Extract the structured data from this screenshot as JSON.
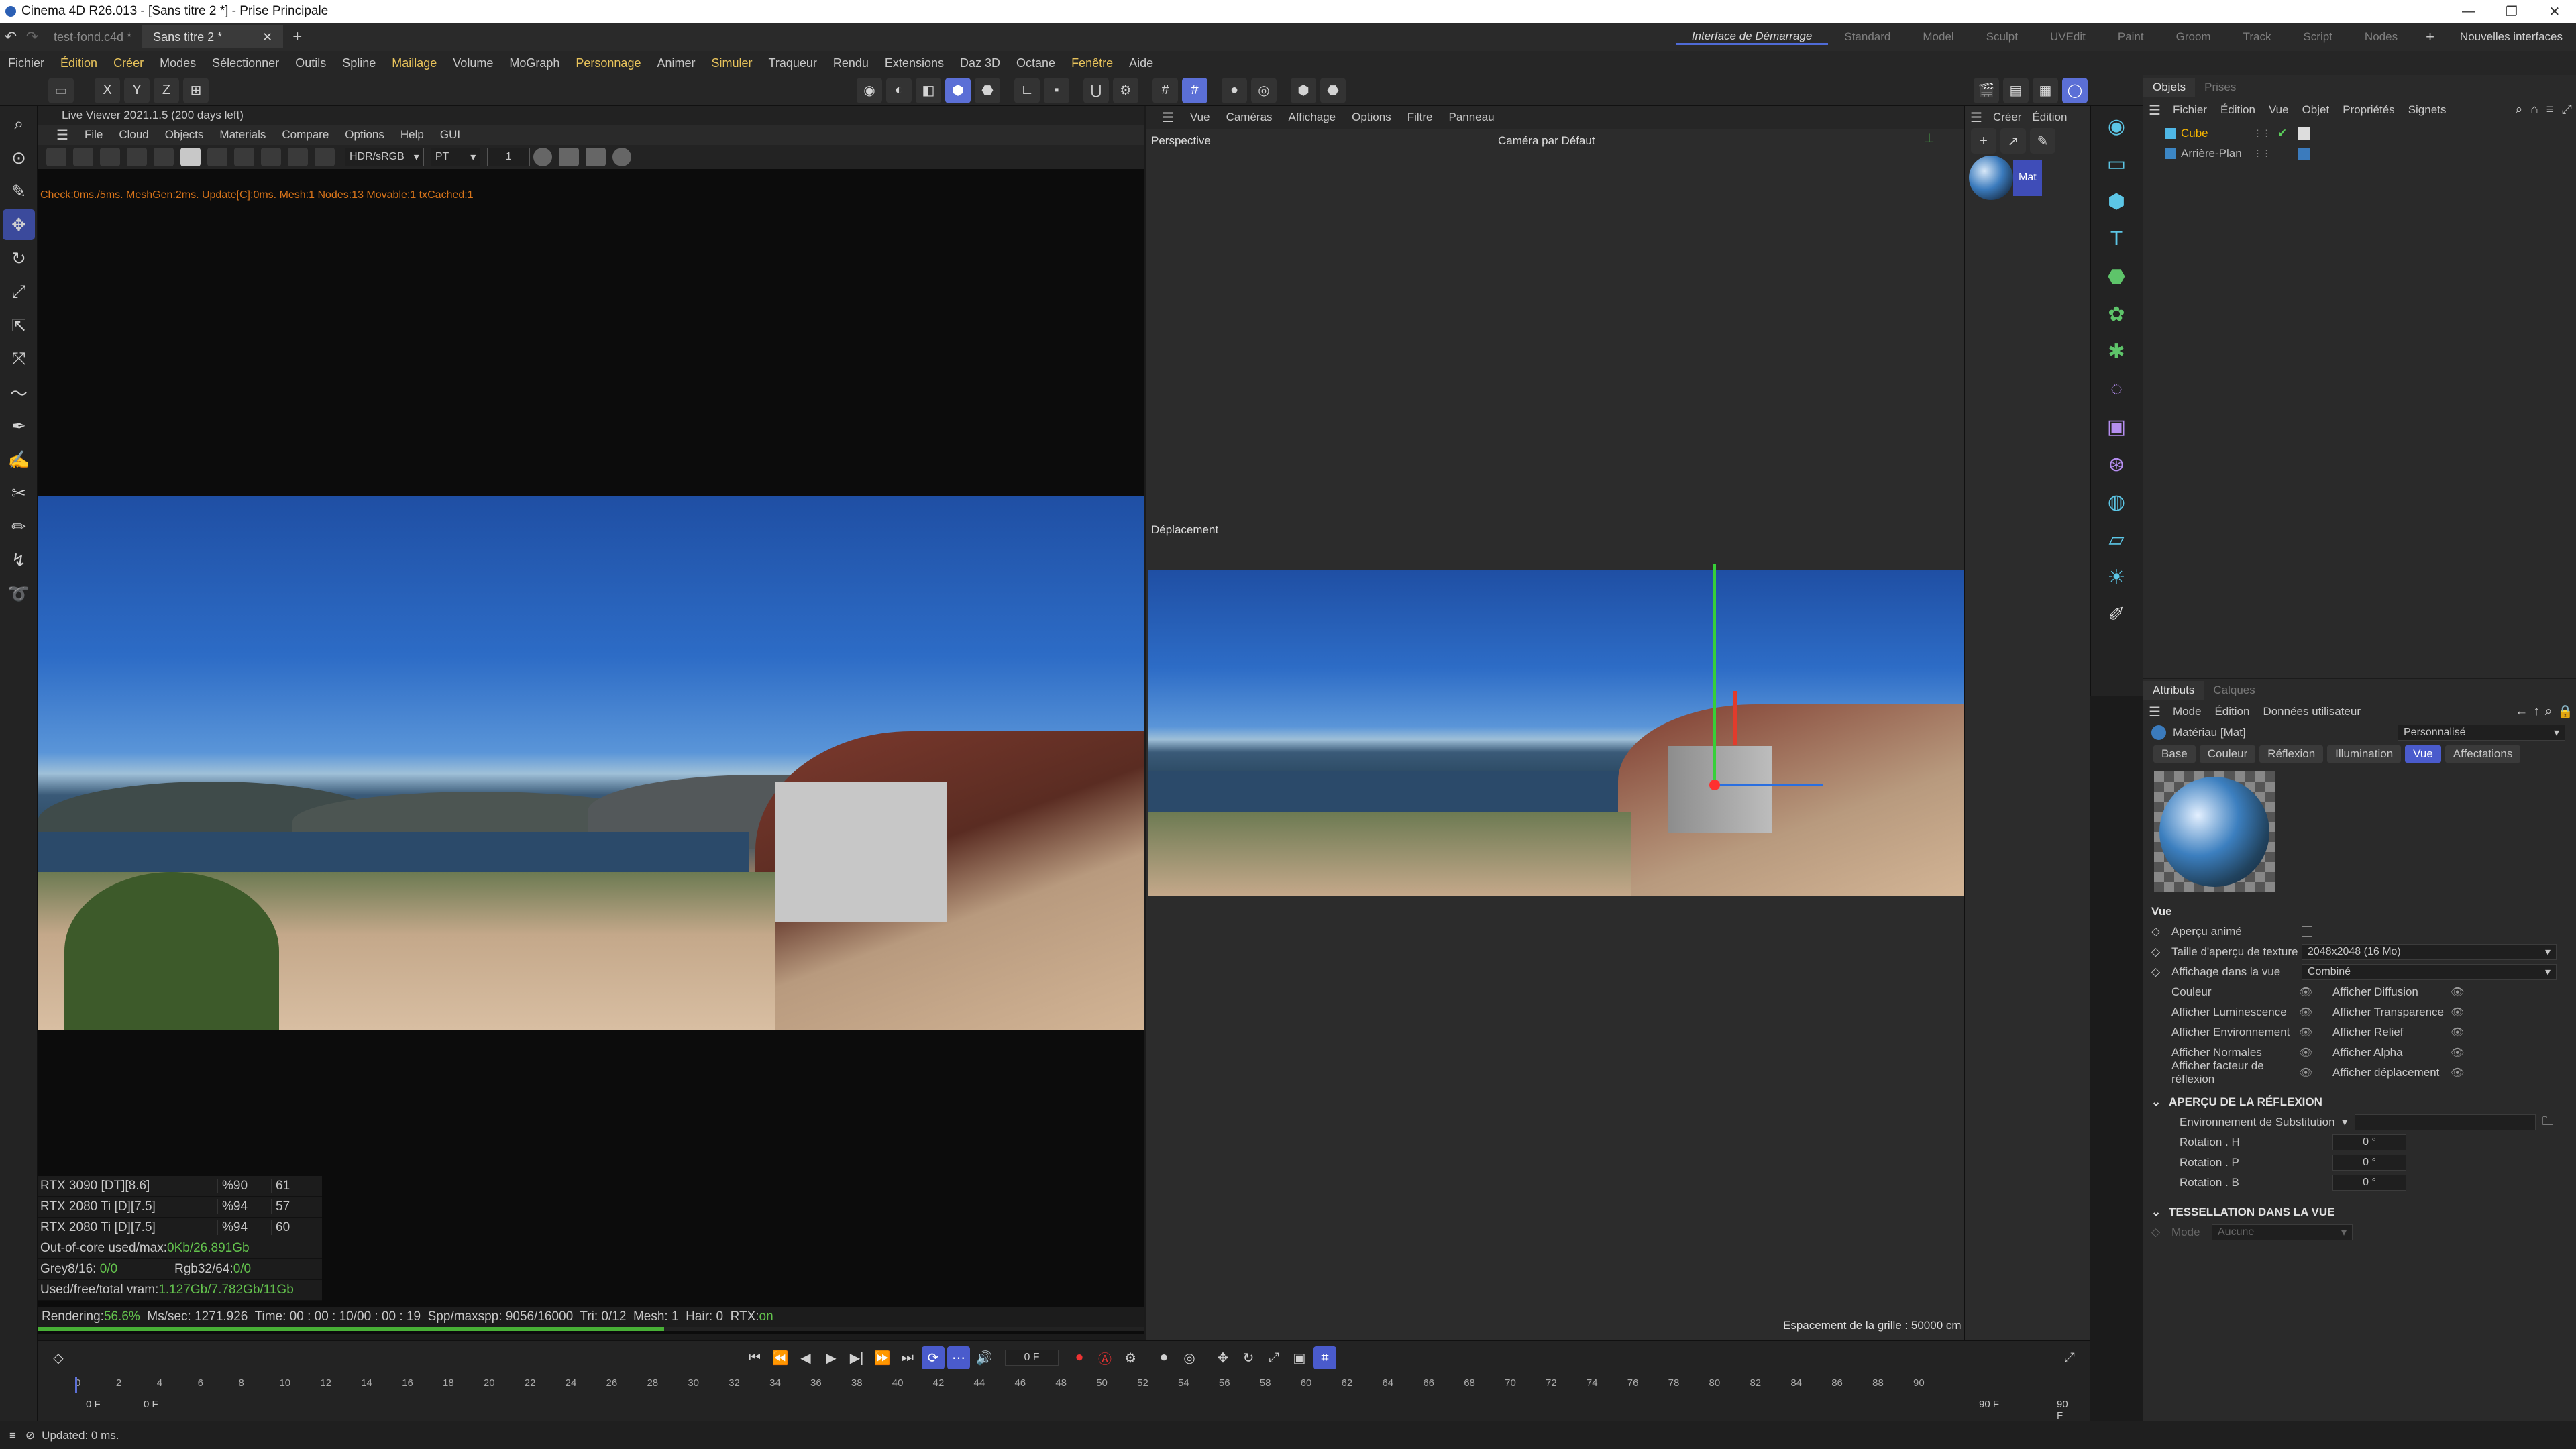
{
  "window": {
    "title": "Cinema 4D R26.013 - [Sans titre 2 *] - Prise Principale",
    "min": "—",
    "max": "❐",
    "close": "✕"
  },
  "tabs": {
    "doc1": "test-fond.c4d *",
    "doc2": "Sans titre 2 *",
    "close": "✕",
    "add": "+"
  },
  "layouts": {
    "active": "Interface de Démarrage",
    "items": [
      "Standard",
      "Model",
      "Sculpt",
      "UVEdit",
      "Paint",
      "Groom",
      "Track",
      "Script",
      "Nodes"
    ],
    "add": "+",
    "new": "Nouvelles interfaces"
  },
  "menubar": [
    {
      "label": "Fichier",
      "y": false
    },
    {
      "label": "Édition",
      "y": true
    },
    {
      "label": "Créer",
      "y": true
    },
    {
      "label": "Modes",
      "y": false
    },
    {
      "label": "Sélectionner",
      "y": false
    },
    {
      "label": "Outils",
      "y": false
    },
    {
      "label": "Spline",
      "y": false
    },
    {
      "label": "Maillage",
      "y": true
    },
    {
      "label": "Volume",
      "y": false
    },
    {
      "label": "MoGraph",
      "y": false
    },
    {
      "label": "Personnage",
      "y": true
    },
    {
      "label": "Animer",
      "y": false
    },
    {
      "label": "Simuler",
      "y": true
    },
    {
      "label": "Traqueur",
      "y": false
    },
    {
      "label": "Rendu",
      "y": false
    },
    {
      "label": "Extensions",
      "y": false
    },
    {
      "label": "Daz 3D",
      "y": false
    },
    {
      "label": "Octane",
      "y": false
    },
    {
      "label": "Fenêtre",
      "y": true
    },
    {
      "label": "Aide",
      "y": false
    }
  ],
  "toolbar": {
    "x": "X",
    "y": "Y",
    "z": "Z"
  },
  "liveviewer": {
    "title": "Live Viewer 2021.1.5 (200 days left)",
    "menu": [
      "File",
      "Cloud",
      "Objects",
      "Materials",
      "Compare",
      "Options",
      "Help",
      "GUI"
    ],
    "colorspace": "HDR/sRGB",
    "mode": "PT",
    "value": "1",
    "status": "Check:0ms./5ms. MeshGen:2ms. Update[C]:0ms. Mesh:1 Nodes:13 Movable:1 txCached:1",
    "gpus": [
      {
        "name": "RTX 3090 [DT][8.6]",
        "pct": "%90",
        "temp": "61"
      },
      {
        "name": "RTX 2080 Ti [D][7.5]",
        "pct": "%94",
        "temp": "57"
      },
      {
        "name": "RTX 2080 Ti [D][7.5]",
        "pct": "%94",
        "temp": "60"
      }
    ],
    "ooc_label": "Out-of-core used/max:",
    "ooc_value": "0Kb/26.891Gb",
    "grey_label": "Grey8/16: ",
    "grey_value": "0/0",
    "rgb_label": "Rgb32/64: ",
    "rgb_value": "0/0",
    "vram_label": "Used/free/total vram: ",
    "vram_value": "1.127Gb/7.782Gb/11Gb",
    "render_label": "Rendering: ",
    "render_pct": "56.6%",
    "render_rest": "  Ms/sec: 1271.926  Time: 00 : 00 : 10/00 : 00 : 19  Spp/maxspp: 9056/16000  Tri: 0/12  Mesh: 1  Hair: 0  RTX:",
    "rtx": "on",
    "progress": 0.566
  },
  "viewport": {
    "menu": [
      "Vue",
      "Caméras",
      "Affichage",
      "Options",
      "Filtre",
      "Panneau"
    ],
    "label": "Perspective",
    "camera": "Caméra par Défaut",
    "mode": "Déplacement",
    "grid": "Espacement de la grille : 50000 cm"
  },
  "materials": {
    "menu": [
      "Créer",
      "Édition"
    ],
    "mat": "Mat"
  },
  "objects": {
    "tabs": [
      "Objets",
      "Prises"
    ],
    "menu": [
      "Fichier",
      "Édition",
      "Vue",
      "Objet",
      "Propriétés",
      "Signets"
    ],
    "items": [
      {
        "name": "Cube",
        "color": "#f5b400"
      },
      {
        "name": "Arrière-Plan",
        "color": "#bdbdbd"
      }
    ]
  },
  "attributes": {
    "tabs": [
      "Attributs",
      "Calques"
    ],
    "menu": [
      "Mode",
      "Édition",
      "Données utilisateur"
    ],
    "material": "Matériau [Mat]",
    "preset": "Personnalisé",
    "subtabs": [
      "Base",
      "Couleur",
      "Réflexion",
      "Illumination",
      "Vue",
      "Affectations"
    ],
    "active_subtab": "Vue",
    "section": "Vue",
    "animated": "Aperçu animé",
    "texsize_label": "Taille d'aperçu de texture",
    "texsize_value": "2048x2048 (16 Mo)",
    "display_label": "Affichage dans la vue",
    "display_value": "Combiné",
    "toggles": [
      [
        "Couleur",
        "Afficher Diffusion"
      ],
      [
        "Afficher Luminescence",
        "Afficher Transparence"
      ],
      [
        "Afficher Environnement",
        "Afficher Relief"
      ],
      [
        "Afficher Normales",
        "Afficher Alpha"
      ],
      [
        "Afficher facteur de réflexion",
        "Afficher déplacement"
      ]
    ],
    "refl_header": "APERÇU DE LA RÉFLEXION",
    "env_label": "Environnement de Substitution",
    "rotations": [
      {
        "label": "Rotation . H",
        "value": "0 °"
      },
      {
        "label": "Rotation . P",
        "value": "0 °"
      },
      {
        "label": "Rotation . B",
        "value": "0 °"
      }
    ],
    "tess_header": "TESSELLATION DANS LA VUE",
    "tess_mode": "Mode",
    "tess_value": "Aucune"
  },
  "timeline": {
    "frame": "0 F",
    "start": "0 F",
    "start2": "0 F",
    "end": "90 F",
    "end2": "90 F",
    "ticks": [
      "0",
      "2",
      "4",
      "6",
      "8",
      "10",
      "12",
      "14",
      "16",
      "18",
      "20",
      "22",
      "24",
      "26",
      "28",
      "30",
      "32",
      "34",
      "36",
      "38",
      "40",
      "42",
      "44",
      "46",
      "48",
      "50",
      "52",
      "54",
      "56",
      "58",
      "60",
      "62",
      "64",
      "66",
      "68",
      "70",
      "72",
      "74",
      "76",
      "78",
      "80",
      "82",
      "84",
      "86",
      "88",
      "90"
    ]
  },
  "status": "Updated: 0 ms."
}
